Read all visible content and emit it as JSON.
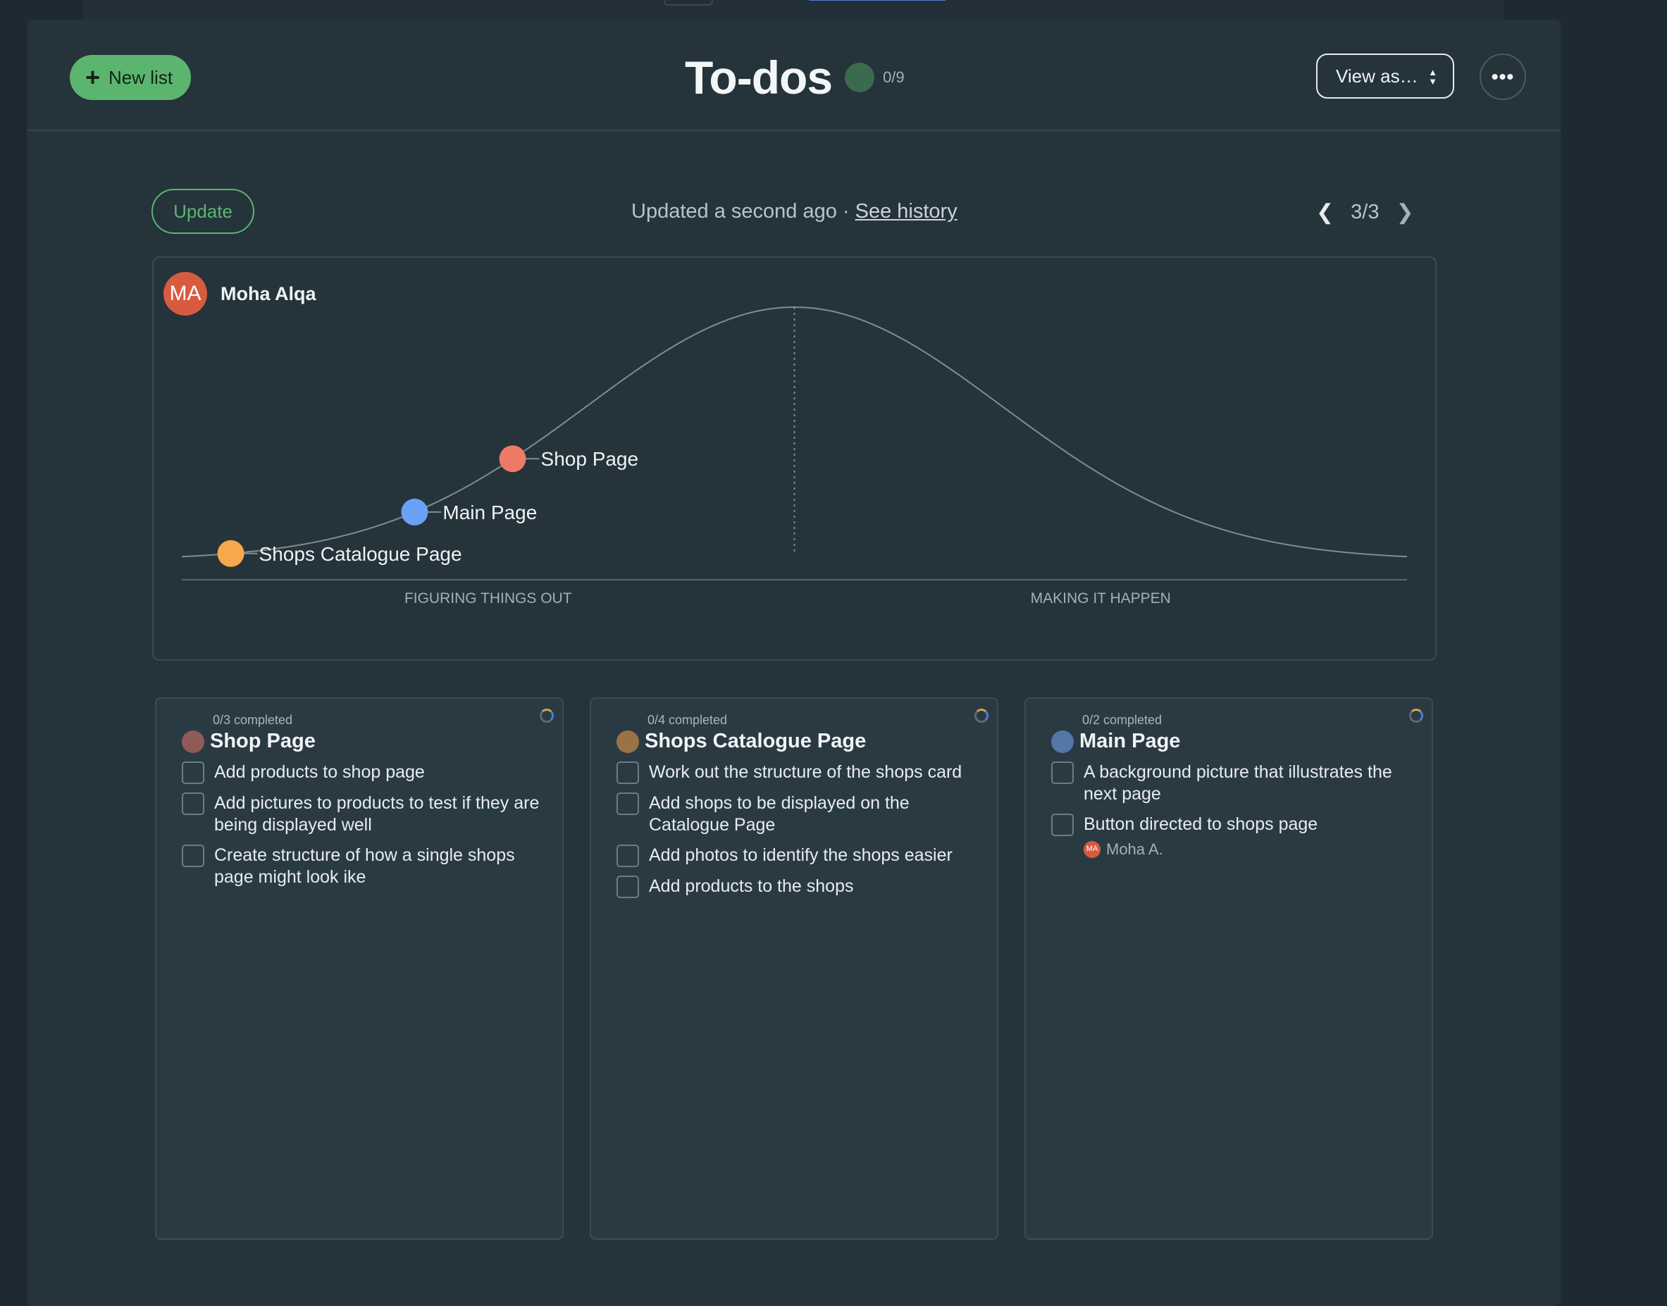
{
  "header": {
    "new_list_label": "New list",
    "title": "To-dos",
    "count": "0/9",
    "view_as_label": "View as…",
    "more_label": "•••"
  },
  "hill_chart": {
    "update_label": "Update",
    "updated_text": "Updated a second ago · ",
    "see_history_label": "See history",
    "pager": "3/3",
    "owner_initials": "MA",
    "owner_name": "Moha Alqa",
    "left_phase": "FIGURING THINGS OUT",
    "right_phase": "MAKING IT HAPPEN"
  },
  "chart_data": {
    "type": "scatter",
    "curve": "hill",
    "xlabel": "",
    "ylabel": "",
    "phases": [
      "FIGURING THINGS OUT",
      "MAKING IT HAPPEN"
    ],
    "points": [
      {
        "label": "Shops Catalogue Page",
        "progress": 4,
        "color": "#f5a94a"
      },
      {
        "label": "Main Page",
        "progress": 19,
        "color": "#6aa1f7"
      },
      {
        "label": "Shop Page",
        "progress": 27,
        "color": "#ec7a66"
      }
    ],
    "xlim": [
      0,
      100
    ]
  },
  "lists": [
    {
      "completed": "0/3 completed",
      "title": "Shop Page",
      "color": "#8f5a57",
      "todos": [
        {
          "text": "Add products to shop page"
        },
        {
          "text": "Add pictures to products to test if they are being displayed well"
        },
        {
          "text": "Create structure of how a single shops page might look ike"
        }
      ]
    },
    {
      "completed": "0/4 completed",
      "title": "Shops Catalogue Page",
      "color": "#9a7248",
      "todos": [
        {
          "text": "Work out the structure of the shops card"
        },
        {
          "text": "Add shops to be displayed on the Catalogue Page"
        },
        {
          "text": "Add photos to identify the shops easier"
        },
        {
          "text": "Add products to the shops"
        }
      ]
    },
    {
      "completed": "0/2 completed",
      "title": "Main Page",
      "color": "#5576a8",
      "todos": [
        {
          "text": "A background picture that illustrates the next page"
        },
        {
          "text": "Button directed to shops page",
          "assignee_initials": "MA",
          "assignee": "Moha A."
        }
      ]
    }
  ]
}
